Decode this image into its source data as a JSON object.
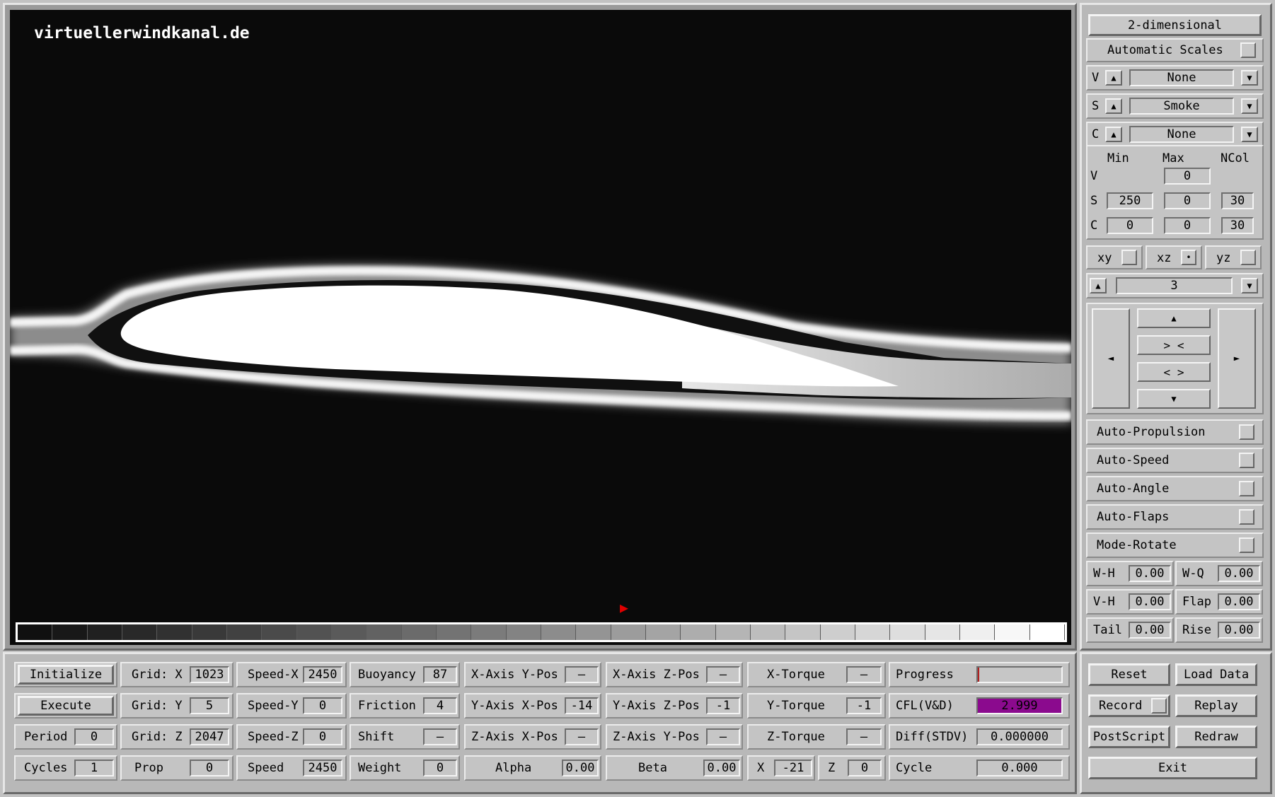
{
  "viewport": {
    "watermark": "virtuellerwindkanal.de",
    "colorbar_steps": 30
  },
  "side": {
    "mode_button": "2-dimensional",
    "auto_scales": "Automatic Scales",
    "selectors": [
      {
        "letter": "V",
        "value": "None"
      },
      {
        "letter": "S",
        "value": "Smoke"
      },
      {
        "letter": "C",
        "value": "None"
      }
    ],
    "range_headers": {
      "min": "Min",
      "max": "Max",
      "ncol": "NCol"
    },
    "ranges": [
      {
        "letter": "V",
        "min": "",
        "max": "0",
        "ncol": ""
      },
      {
        "letter": "S",
        "min": "250",
        "max": "0",
        "ncol": "30"
      },
      {
        "letter": "C",
        "min": "0",
        "max": "0",
        "ncol": "30"
      }
    ],
    "planes": [
      {
        "label": "xy",
        "mark": ""
      },
      {
        "label": "xz",
        "mark": "•"
      },
      {
        "label": "yz",
        "mark": ""
      }
    ],
    "slice_value": "3",
    "nav": {
      "up": "▲",
      "zoom_in": "> <",
      "zoom_out": "< >",
      "down": "▼",
      "left": "◄",
      "right": "►"
    },
    "toggles": [
      "Auto-Propulsion",
      "Auto-Speed",
      "Auto-Angle",
      "Auto-Flaps",
      "Mode-Rotate"
    ],
    "params": [
      [
        {
          "label": "W-H",
          "value": "0.00"
        },
        {
          "label": "W-Q",
          "value": "0.00"
        }
      ],
      [
        {
          "label": "V-H",
          "value": "0.00"
        },
        {
          "label": "Flap",
          "value": "0.00"
        }
      ],
      [
        {
          "label": "Tail",
          "value": "0.00"
        },
        {
          "label": "Rise",
          "value": "0.00"
        }
      ]
    ]
  },
  "bottom": {
    "initialize": "Initialize",
    "execute": "Execute",
    "period": {
      "label": "Period",
      "value": "0"
    },
    "cycles": {
      "label": "Cycles",
      "value": "1"
    },
    "grid_x": {
      "label": "Grid: X",
      "value": "1023"
    },
    "grid_y": {
      "label": "Grid: Y",
      "value": "5"
    },
    "grid_z": {
      "label": "Grid: Z",
      "value": "2047"
    },
    "prop": {
      "label": "Prop",
      "value": "0"
    },
    "speed_x": {
      "label": "Speed-X",
      "value": "2450"
    },
    "speed_y": {
      "label": "Speed-Y",
      "value": "0"
    },
    "speed_z": {
      "label": "Speed-Z",
      "value": "0"
    },
    "speed": {
      "label": "Speed",
      "value": "2450"
    },
    "buoyancy": {
      "label": "Buoyancy",
      "value": "87"
    },
    "friction": {
      "label": "Friction",
      "value": "4"
    },
    "shift": {
      "label": "Shift",
      "value": "—"
    },
    "weight": {
      "label": "Weight",
      "value": "0"
    },
    "xaxis_ypos": {
      "label": "X-Axis Y-Pos",
      "value": "—"
    },
    "yaxis_xpos": {
      "label": "Y-Axis X-Pos",
      "value": "-14"
    },
    "zaxis_xpos": {
      "label": "Z-Axis X-Pos",
      "value": "—"
    },
    "alpha": {
      "label": "Alpha",
      "value": "0.00"
    },
    "xaxis_zpos": {
      "label": "X-Axis Z-Pos",
      "value": "—"
    },
    "yaxis_zpos": {
      "label": "Y-Axis Z-Pos",
      "value": "-1"
    },
    "zaxis_ypos": {
      "label": "Z-Axis Y-Pos",
      "value": "—"
    },
    "beta": {
      "label": "Beta",
      "value": "0.00"
    },
    "x_torque": {
      "label": "X-Torque",
      "value": "—"
    },
    "y_torque": {
      "label": "Y-Torque",
      "value": "-1"
    },
    "z_torque": {
      "label": "Z-Torque",
      "value": "—"
    },
    "x_pos": {
      "label": "X",
      "value": "-21"
    },
    "z_pos": {
      "label": "Z",
      "value": "0"
    },
    "progress": {
      "label": "Progress",
      "value": 0.01
    },
    "cfl": {
      "label": "CFL(V&D)",
      "value": "2.999",
      "color": "#8b0a8e"
    },
    "diff": {
      "label": "Diff(STDV)",
      "value": "0.000000"
    },
    "cycle": {
      "label": "Cycle",
      "value": "0.000"
    },
    "reset": "Reset",
    "load_data": "Load Data",
    "record": "Record",
    "replay": "Replay",
    "postscript": "PostScript",
    "redraw": "Redraw",
    "exit": "Exit"
  }
}
